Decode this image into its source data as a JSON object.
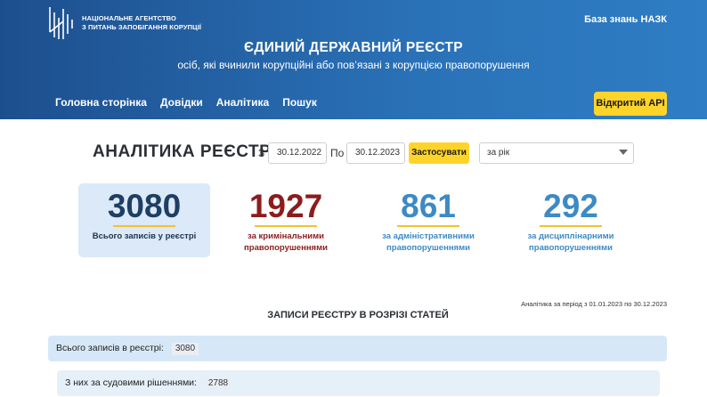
{
  "header": {
    "agency_line1": "НАЦІОНАЛЬНЕ АГЕНТСТВО",
    "agency_line2": "З ПИТАНЬ ЗАПОБІГАННЯ КОРУПЦІЇ",
    "knowledge_base_link": "База знань НАЗК",
    "registry_title": "ЄДИНИЙ ДЕРЖАВНИЙ РЕЄСТР",
    "registry_subtitle": "осіб, які вчинили корупційні або пов’язані з корупцією правопорушення",
    "nav": [
      "Головна сторінка",
      "Довідки",
      "Аналітика",
      "Пошук"
    ],
    "api_button": "Відкритий API",
    "colors": {
      "header_start": "#1d4f8e",
      "header_end": "#2f7dc4",
      "accent": "#ffd42a"
    }
  },
  "filters": {
    "title": "АНАЛІТИКА РЕЄСТРУ",
    "from_label": "З",
    "from_value": "30.12.2022",
    "to_label": "По",
    "to_value": "30.12.2023",
    "apply_button": "Застосувати",
    "period_select": "за рік"
  },
  "stats": {
    "total": {
      "value": "3080",
      "label": "Всього записів у реєстрі"
    },
    "criminal": {
      "value": "1927",
      "label_line1": "за кримінальними",
      "label_line2": "правопорушеннями"
    },
    "administrative": {
      "value": "861",
      "label_line1": "за адміністративними",
      "label_line2": "правопорушеннями"
    },
    "disciplinary": {
      "value": "292",
      "label_line1": "за дисциплінарними",
      "label_line2": "правопорушеннями"
    }
  },
  "period_note": "Аналітика за період з 01.01.2023 по 30.12.2023",
  "section_title": "ЗАПИСИ РЕЄСТРУ В РОЗРІЗІ СТАТЕЙ",
  "rows": [
    {
      "label": "Всього записів в реєстрі:",
      "value": "3080"
    },
    {
      "label": "З них за судовими рішеннями:",
      "value": "2788"
    }
  ]
}
